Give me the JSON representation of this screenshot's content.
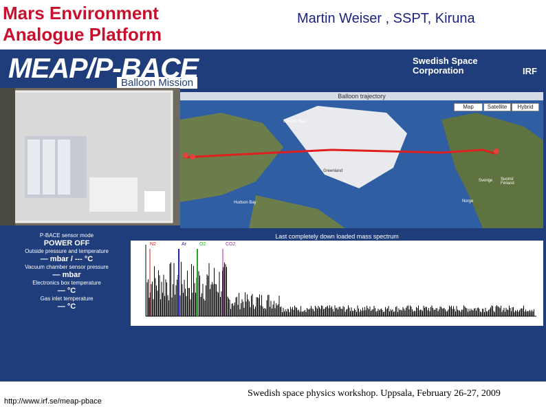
{
  "slide": {
    "title_line1": "Mars Environment",
    "title_line2": "Analogue Platform",
    "author": "Martin Weiser , SSPT, Kiruna",
    "logo": "MEAP/P-BACE",
    "logo_sub": "Balloon Mission",
    "partner_ssc_line1": "Swedish Space",
    "partner_ssc_line2": "Corporation",
    "partner_irf": "IRF",
    "url": "http://www.irf.se/meap-pbace",
    "footer": "Swedish space physics workshop. Uppsala, February 26-27, 2009"
  },
  "map": {
    "header": "Balloon trajectory",
    "buttons": [
      "Map",
      "Satellite",
      "Hybrid"
    ],
    "labels": [
      "Barents Sea",
      "Greenland",
      "Hudson Bay",
      "Sverige",
      "Suomi/ Finland",
      "Norge"
    ],
    "colors": {
      "trajectory": "#e02020",
      "marker": "#e0443a"
    }
  },
  "sensor": {
    "title": "P-BACE sensor mode",
    "mode": "POWER OFF",
    "outside_label": "Outside pressure and temperature",
    "outside_value": "— mbar / --- °C",
    "vacuum_label": "Vacuum chamber sensor pressure",
    "vacuum_value": "— mbar",
    "electronics_label": "Electronics box temperature",
    "electronics_value": "— °C",
    "gasinlet_label": "Gas inlet temperature",
    "gasinlet_value": "— °C"
  },
  "spectrum": {
    "header": "Last completely down loaded mass spectrum",
    "markers": [
      {
        "name": "N2",
        "color": "#cc2222"
      },
      {
        "name": "Ar",
        "color": "#2222cc"
      },
      {
        "name": "O2",
        "color": "#22aa22"
      },
      {
        "name": "CO2",
        "color": "#aa22aa"
      }
    ]
  }
}
